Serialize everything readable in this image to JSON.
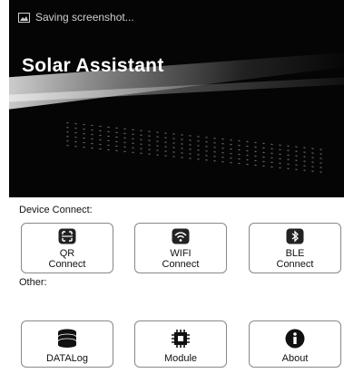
{
  "status_bar": {
    "text": "Saving screenshot..."
  },
  "app": {
    "title": "Solar Assistant"
  },
  "device_connect": {
    "label": "Device Connect:",
    "buttons": [
      {
        "line1": "QR",
        "line2": "Connect",
        "icon": "qr-scan-icon"
      },
      {
        "line1": "WIFI",
        "line2": "Connect",
        "icon": "wifi-icon"
      },
      {
        "line1": "BLE",
        "line2": "Connect",
        "icon": "bluetooth-icon"
      }
    ]
  },
  "other": {
    "label": "Other:",
    "buttons": [
      {
        "label": "DATALog",
        "icon": "database-icon"
      },
      {
        "label": "Module",
        "icon": "chip-icon"
      },
      {
        "label": "About",
        "icon": "info-icon"
      }
    ]
  }
}
